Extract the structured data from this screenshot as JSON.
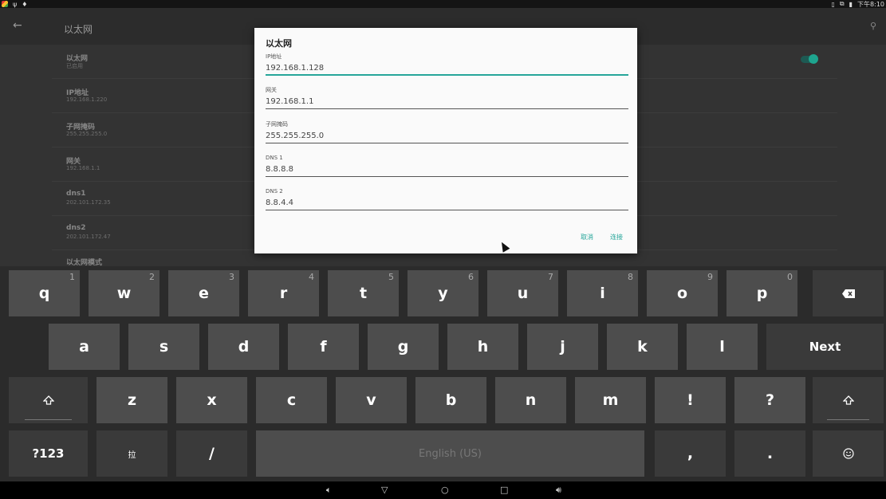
{
  "status_bar": {
    "time": "下午8:10"
  },
  "app_bar": {
    "title": "以太网"
  },
  "settings_rows": [
    {
      "title": "以太网",
      "subtitle": "已启用"
    },
    {
      "title": "IP地址",
      "subtitle": "192.168.1.220"
    },
    {
      "title": "子网掩码",
      "subtitle": "255.255.255.0"
    },
    {
      "title": "网关",
      "subtitle": "192.168.1.1"
    },
    {
      "title": "dns1",
      "subtitle": "202.101.172.35"
    },
    {
      "title": "dns2",
      "subtitle": "202.101.172.47"
    },
    {
      "title": "以太网模式",
      "subtitle": ""
    }
  ],
  "dialog": {
    "title": "以太网",
    "fields": [
      {
        "label": "IP地址",
        "value": "192.168.1.128"
      },
      {
        "label": "网关",
        "value": "192.168.1.1"
      },
      {
        "label": "子网掩码",
        "value": "255.255.255.0"
      },
      {
        "label": "DNS 1",
        "value": "8.8.8.8"
      },
      {
        "label": "DNS 2",
        "value": "8.8.4.4"
      }
    ],
    "cancel": "取消",
    "connect": "连接"
  },
  "keyboard": {
    "row1": [
      {
        "key": "q",
        "hint": "1"
      },
      {
        "key": "w",
        "hint": "2"
      },
      {
        "key": "e",
        "hint": "3"
      },
      {
        "key": "r",
        "hint": "4"
      },
      {
        "key": "t",
        "hint": "5"
      },
      {
        "key": "y",
        "hint": "6"
      },
      {
        "key": "u",
        "hint": "7"
      },
      {
        "key": "i",
        "hint": "8"
      },
      {
        "key": "o",
        "hint": "9"
      },
      {
        "key": "p",
        "hint": "0"
      }
    ],
    "row2": [
      "a",
      "s",
      "d",
      "f",
      "g",
      "h",
      "j",
      "k",
      "l"
    ],
    "next": "Next",
    "row3": [
      "z",
      "x",
      "c",
      "v",
      "b",
      "n",
      "m",
      "!",
      "?"
    ],
    "symbols": "?123",
    "lang_icon": "拉",
    "slash": "/",
    "space": "English (US)",
    "comma": ",",
    "period": "."
  },
  "icons": {
    "backspace": "backspace-icon",
    "shift": "shift-icon",
    "emoji": "emoji-icon",
    "back": "back-arrow-icon",
    "search": "search-icon"
  },
  "colors": {
    "accent": "#26a69a",
    "key": "#4d4d4d",
    "key_dark": "#3a3a3a"
  }
}
